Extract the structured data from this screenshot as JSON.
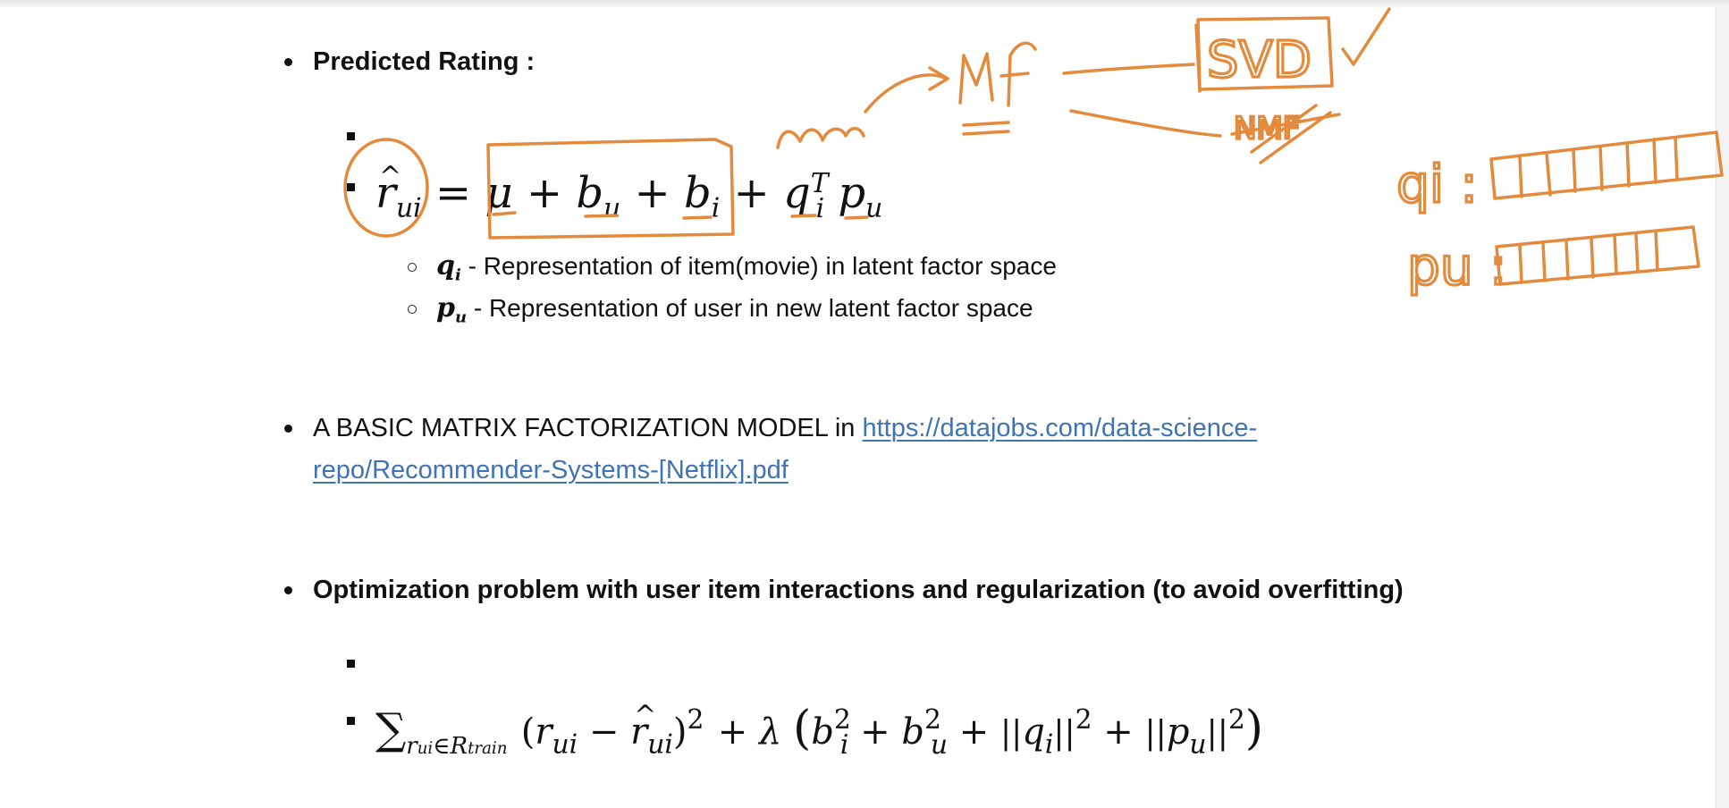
{
  "section1": {
    "heading": "Predicted Rating :",
    "formula": {
      "lhs": "r",
      "lhs_sub": "ui",
      "equals": "=",
      "mu": "μ",
      "plus": "+",
      "b": "b",
      "b_u_sub": "u",
      "b_i_sub": "i",
      "q": "q",
      "q_sub": "i",
      "q_sup": "T",
      "p": "p",
      "p_sub": "u"
    },
    "definitions": [
      {
        "symbol": "q",
        "symbol_sub": "i",
        "text": " - Representation of item(movie) in latent factor space"
      },
      {
        "symbol": "p",
        "symbol_sub": "u",
        "text": " - Representation of user in new latent factor space"
      }
    ]
  },
  "section2": {
    "text": "A BASIC MATRIX FACTORIZATION MODEL in ",
    "link_line1": "https://datajobs.com/data-science-",
    "link_line2": "repo/Recommender-Systems-[Netflix].pdf"
  },
  "section3": {
    "heading": "Optimization problem with user item interactions and regularization (to avoid overfitting)",
    "formula": {
      "sum": "∑",
      "sum_sub": "r",
      "sum_sub2": "ui",
      "sum_sub3": "∈R",
      "sum_sub4": "train",
      "open": "(",
      "r": "r",
      "r_sub": "ui",
      "minus": " − ",
      "rhat": "r",
      "rhat_sub": "ui",
      "close_sq": ")",
      "sq": "2",
      "plus_lambda": " + λ ",
      "big_open": "(",
      "b": "b",
      "bi_sub": "i",
      "bu_sub": "u",
      "plus": " + ",
      "norm": "||",
      "q": "q",
      "q_sub": "i",
      "p": "p",
      "p_sub": "u",
      "big_close": ")"
    }
  },
  "annotations": {
    "mf": "MF",
    "svd": "SVD",
    "nmf": "NMF",
    "qi": "qi :",
    "pu": "pu :"
  },
  "colors": {
    "ink": "#e38a3c",
    "link": "#3f73b4",
    "text": "#111111"
  }
}
